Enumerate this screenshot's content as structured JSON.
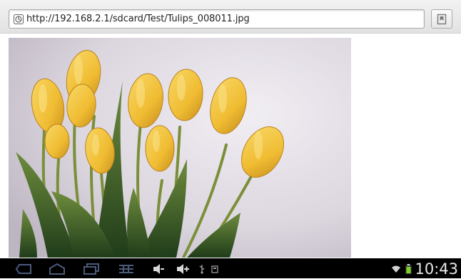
{
  "browser": {
    "url": "http://192.168.2.1/sdcard/Test/Tulips_008011.jpg",
    "page_icon": "page-icon",
    "bookmark_icon": "bookmark-icon"
  },
  "content": {
    "image_subject": "yellow tulips"
  },
  "navbar": {
    "buttons": [
      "back-icon",
      "home-icon",
      "recent-apps-icon",
      "menu-grid-icon",
      "volume-down-icon",
      "volume-up-icon"
    ],
    "status_icons": [
      "usb-icon",
      "notification-icon",
      "wifi-icon",
      "battery-icon"
    ],
    "time": "10:43"
  },
  "colors": {
    "accent": "#6699cc",
    "navbar": "#000000",
    "tulip": "#f2c43a"
  }
}
